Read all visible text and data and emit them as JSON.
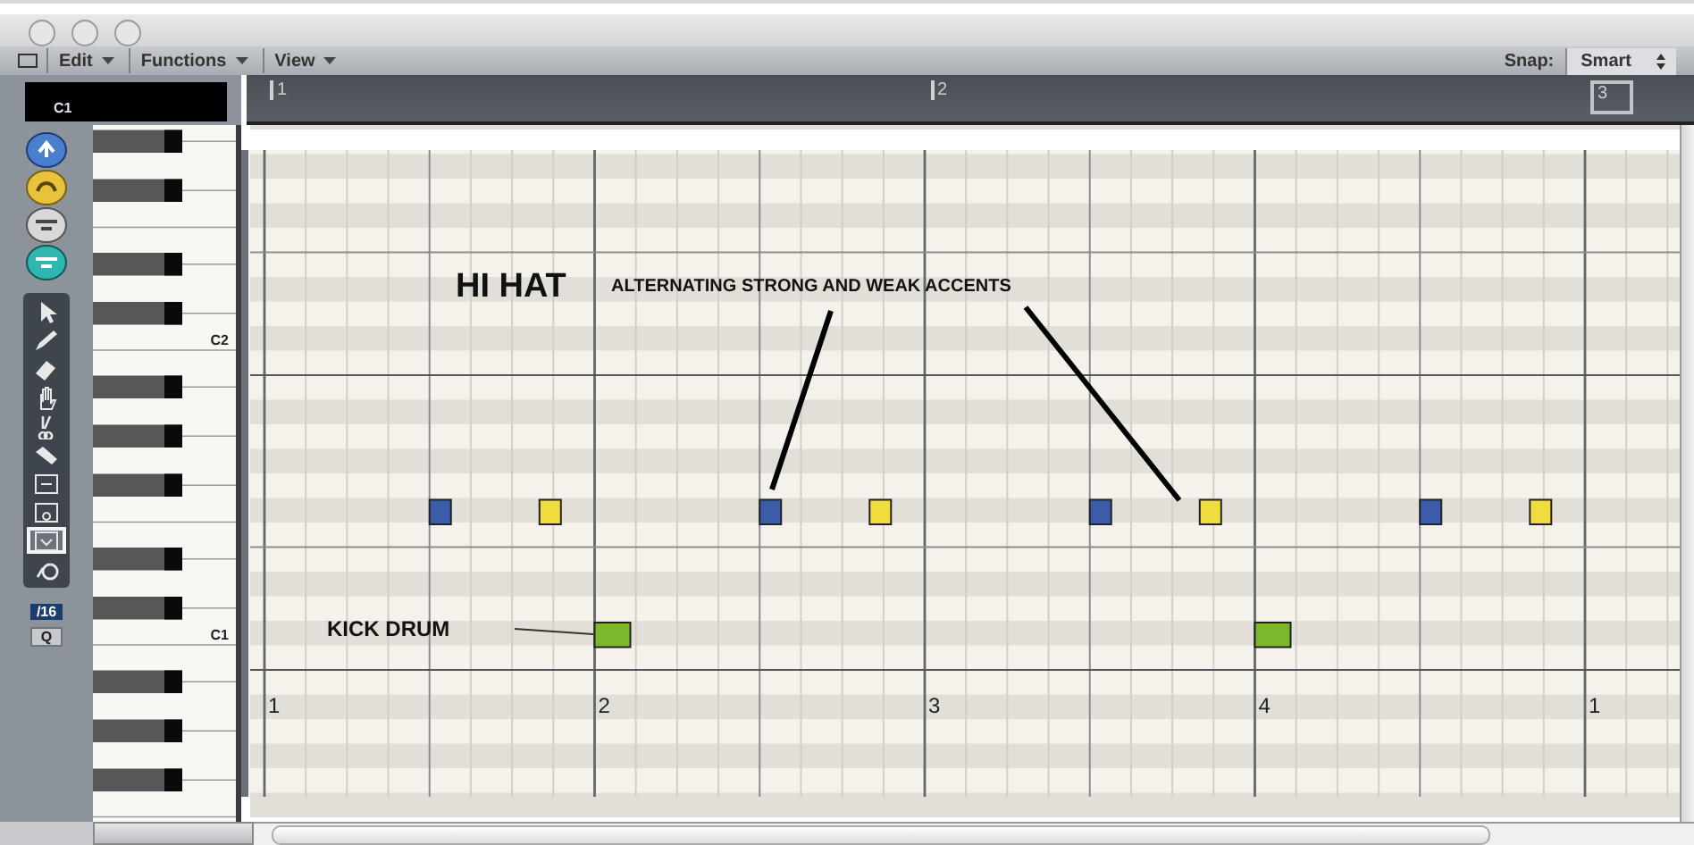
{
  "menu": [
    "Edit",
    "Functions",
    "View"
  ],
  "snap": {
    "label": "Snap:",
    "value": "Smart"
  },
  "pitch_display": "C1",
  "tools": [
    {
      "kind": "pointer",
      "selected": false
    },
    {
      "kind": "pencil",
      "selected": false
    },
    {
      "kind": "eraser",
      "selected": false
    },
    {
      "kind": "hand",
      "selected": false
    },
    {
      "kind": "scissors",
      "selected": false
    },
    {
      "kind": "glue",
      "selected": false
    },
    {
      "kind": "solo",
      "selected": false
    },
    {
      "kind": "mute",
      "selected": false
    },
    {
      "kind": "automation",
      "selected": true
    },
    {
      "kind": "zoom",
      "selected": false
    }
  ],
  "quantize": {
    "value": "/16",
    "button": "Q"
  },
  "ruler": {
    "bars": [
      {
        "label": "1",
        "highlighted": false
      },
      {
        "label": "2",
        "highlighted": false
      },
      {
        "label": "3",
        "highlighted": true
      }
    ]
  },
  "keyboard": {
    "octave_labels": [
      "C2",
      "C1"
    ]
  },
  "grid": {
    "beat_labels": [
      "1",
      "2",
      "3",
      "4",
      "1"
    ]
  },
  "notes": [
    {
      "kind": "hihat",
      "color": "#3b5ca8"
    },
    {
      "kind": "hihat",
      "color": "#f0dc3c"
    },
    {
      "kind": "hihat",
      "color": "#3b5ca8"
    },
    {
      "kind": "hihat",
      "color": "#f0dc3c"
    },
    {
      "kind": "hihat",
      "color": "#3b5ca8"
    },
    {
      "kind": "hihat",
      "color": "#f0dc3c"
    },
    {
      "kind": "hihat",
      "color": "#3b5ca8"
    },
    {
      "kind": "hihat",
      "color": "#f0dc3c"
    },
    {
      "kind": "kick",
      "color": "#7cb82c"
    },
    {
      "kind": "kick",
      "color": "#7cb82c"
    }
  ],
  "annotations": [
    {
      "kind": "title",
      "text": "HI HAT"
    },
    {
      "kind": "caption",
      "text": "ALTERNATING STRONG AND WEAK ACCENTS"
    },
    {
      "kind": "label",
      "text": "KICK DRUM"
    }
  ]
}
